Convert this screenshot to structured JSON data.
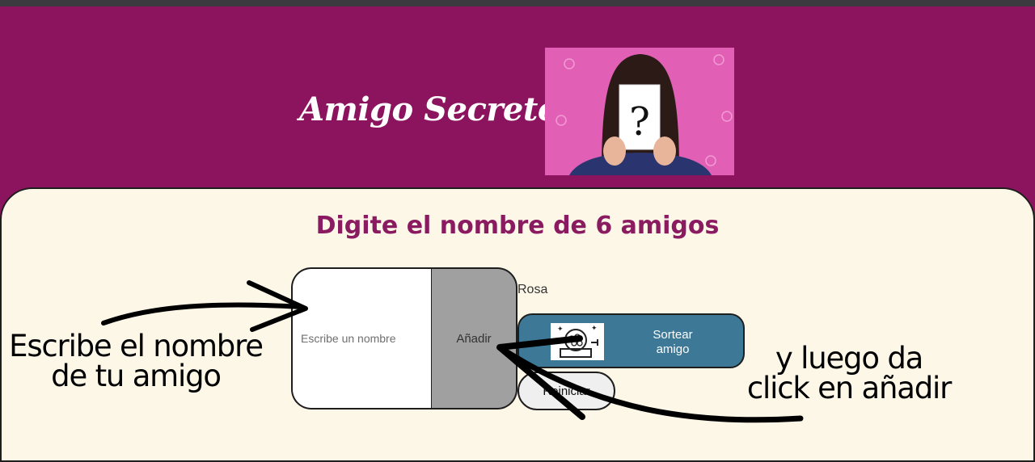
{
  "header": {
    "title": "Amigo Secreto",
    "image_question_mark": "?"
  },
  "main": {
    "subtitle": "Digite el nombre de 6 amigos",
    "input": {
      "placeholder": "Escribe un nombre",
      "value": ""
    },
    "add_button_label": "Añadir",
    "friends_list": [
      "Rosa"
    ],
    "draw_button_label": "Sortear amigo",
    "reset_button_label": "Reiniciar"
  },
  "annotations": {
    "left_text_line1": "Escribe el nombre",
    "left_text_line2": "de tu amigo",
    "right_text_line1": "y luego da",
    "right_text_line2": "click en añadir"
  },
  "colors": {
    "header_bg": "#8c135e",
    "panel_bg": "#fdf7e8",
    "subtitle": "#8a1b60",
    "draw_button": "#3d7896",
    "add_button": "#a0a0a0"
  },
  "icons": [
    "mystery-woman-image",
    "lottery-machine-icon"
  ]
}
